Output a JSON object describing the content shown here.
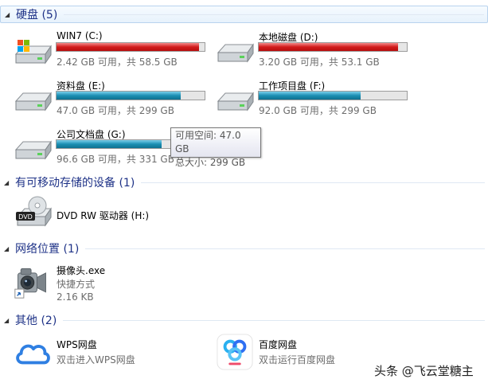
{
  "groups": {
    "hard_disks": {
      "title": "硬盘 (5)"
    },
    "removable": {
      "title": "有可移动存储的设备 (1)"
    },
    "network": {
      "title": "网络位置 (1)"
    },
    "other": {
      "title": "其他 (2)"
    }
  },
  "drives": [
    {
      "name": "WIN7 (C:)",
      "info": "2.42 GB 可用，共 58.5 GB",
      "used_fraction": 0.96,
      "bar_color": "#c81414",
      "icon": "windows-drive-icon"
    },
    {
      "name": "本地磁盘 (D:)",
      "info": "3.20 GB 可用，共 53.1 GB",
      "used_fraction": 0.94,
      "bar_color": "#c81414",
      "icon": "hard-drive-icon"
    },
    {
      "name": "资料盘 (E:)",
      "info": "47.0 GB 可用，共 299 GB",
      "used_fraction": 0.84,
      "bar_color": "#1b8fb3",
      "icon": "hard-drive-icon"
    },
    {
      "name": "工作项目盘 (F:)",
      "info": "92.0 GB 可用，共 299 GB",
      "used_fraction": 0.69,
      "bar_color": "#1b8fb3",
      "icon": "hard-drive-icon"
    },
    {
      "name": "公司文档盘 (G:)",
      "info": "96.6 GB 可用，共 331 GB",
      "used_fraction": 0.71,
      "bar_color": "#1b8fb3",
      "icon": "hard-drive-icon"
    }
  ],
  "tooltip": {
    "free": "可用空间: 47.0 GB",
    "total": "总大小: 299 GB"
  },
  "removable_device": {
    "name": "DVD RW 驱动器 (H:)",
    "icon": "dvd-drive-icon"
  },
  "network_item": {
    "name": "摄像头.exe",
    "type": "快捷方式",
    "size": "2.16 KB",
    "icon": "webcam-icon"
  },
  "other_items": [
    {
      "name": "WPS网盘",
      "desc": "双击进入WPS网盘",
      "icon": "wps-cloud-icon"
    },
    {
      "name": "百度网盘",
      "desc": "双击运行百度网盘",
      "icon": "baidu-netdisk-icon"
    }
  ],
  "watermark": "头条 @飞云堂糖主"
}
